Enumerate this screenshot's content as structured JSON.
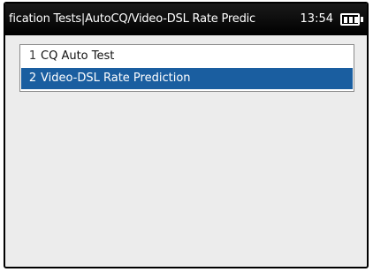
{
  "header": {
    "title": "fication Tests|AutoCQ/Video-DSL Rate Predic",
    "time": "13:54",
    "battery_icon": "battery-icon",
    "battery_level": 0.75
  },
  "menu": {
    "items": [
      {
        "number": "1",
        "label": "CQ Auto Test",
        "selected": false
      },
      {
        "number": "2",
        "label": "Video-DSL Rate Prediction",
        "selected": true
      }
    ],
    "selected_color": "#1a5ea0"
  },
  "colors": {
    "titlebar": "#000000",
    "background": "#ececec",
    "selection": "#1a5ea0"
  }
}
